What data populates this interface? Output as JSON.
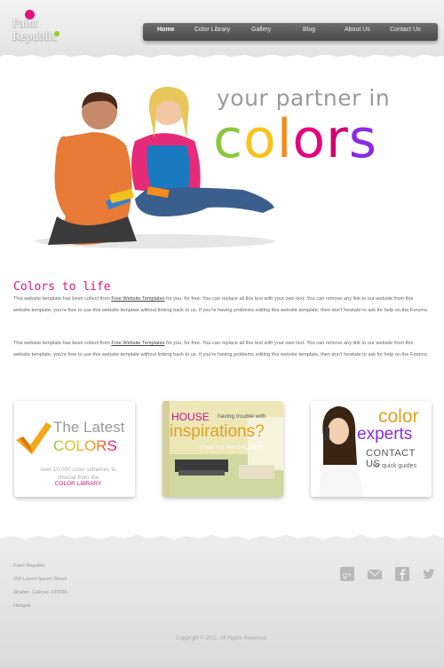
{
  "logo": {
    "line1": "Paint",
    "line2": "Republic"
  },
  "nav": {
    "items": [
      "Home",
      "Color Library",
      "Gallery",
      "Blog",
      "About Us",
      "Contact Us"
    ]
  },
  "hero": {
    "tagline_1": "your partner in",
    "tagline_2_letters": [
      "c",
      "o",
      "l",
      "o",
      "r",
      "s"
    ],
    "tagline_2_colors": [
      "#8cc63f",
      "#f7c21a",
      "#f28c1a",
      "#e6007e",
      "#d0006f",
      "#8a2be2"
    ]
  },
  "content": {
    "title": "Colors to life",
    "para_prefix": "This website template has been collect from ",
    "link": "Free Website Templates",
    "para_suffix": " for you, for free. You can replace all this text with your own text. You can remove any link to our website from this website template, you're free to use this website template without linking back to us. If you're having problems editing this website template, then don't hesitate to ask for help on the Forums."
  },
  "promos": {
    "latest": {
      "line1": "The Latest",
      "line2": "COLORS",
      "small": "over 10,000 color schemes to choose from the",
      "link": "COLOR LIBRARY"
    },
    "house": {
      "house": "HOUSE",
      "trouble": "having trouble with",
      "inspirations": "inspirations?",
      "check": "check out the GALLERY"
    },
    "experts": {
      "color": "color",
      "experts": "experts",
      "contact": "CONTACT US",
      "guides": "for quick guides"
    }
  },
  "footer": {
    "address": [
      "Paint Republic",
      "250 Lorem Ipsum Street",
      "Jinafen, Caknan 109935",
      "Hangab"
    ],
    "social_icons": [
      "google-plus-icon",
      "mail-icon",
      "facebook-icon",
      "twitter-icon"
    ],
    "copyright": "Copyright © 2011. All Rights Reserved."
  },
  "colors": {
    "brand_pink": "#e0157f",
    "nav_bg": "#555555"
  }
}
